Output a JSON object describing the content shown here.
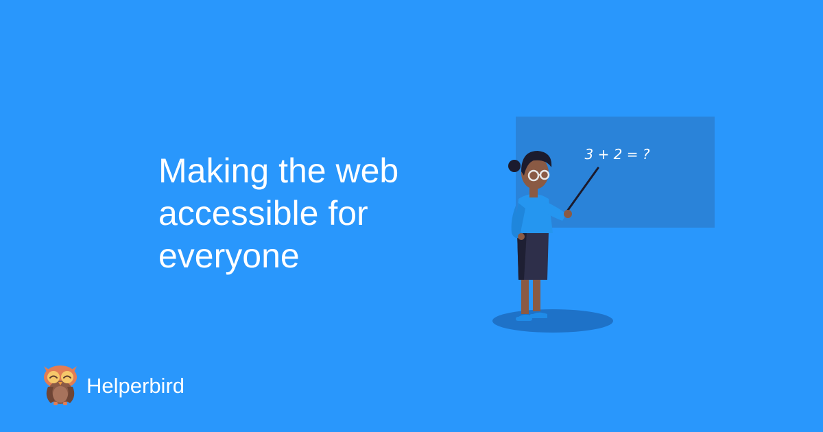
{
  "hero": {
    "headline_lines": [
      "Making the web",
      "accessible for",
      "everyone"
    ]
  },
  "illustration": {
    "board_equation": "3 + 2 = ?",
    "subject": "teacher-with-pointer"
  },
  "brand": {
    "name": "Helperbird",
    "logo_icon": "owl-icon"
  },
  "colors": {
    "background": "#2997FC",
    "board": "#2A83D9",
    "text": "#FFFFFF"
  }
}
